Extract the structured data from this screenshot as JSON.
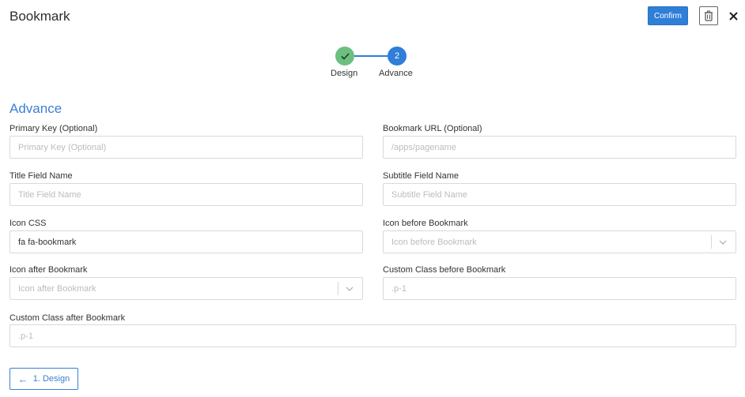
{
  "header": {
    "title": "Bookmark",
    "confirm_label": "Confirm"
  },
  "stepper": {
    "steps": [
      {
        "label": "Design",
        "status": "complete"
      },
      {
        "label": "Advance",
        "number": "2",
        "status": "active"
      }
    ]
  },
  "section": {
    "title": "Advance"
  },
  "fields": {
    "primary_key": {
      "label": "Primary Key (Optional)",
      "placeholder": "Primary Key (Optional)",
      "value": ""
    },
    "bookmark_url": {
      "label": "Bookmark URL (Optional)",
      "placeholder": "/apps/pagename",
      "value": ""
    },
    "title_field": {
      "label": "Title Field Name",
      "placeholder": "Title Field Name",
      "value": ""
    },
    "subtitle_field": {
      "label": "Subtitle Field Name",
      "placeholder": "Subtitle Field Name",
      "value": ""
    },
    "icon_css": {
      "label": "Icon CSS",
      "placeholder": "",
      "value": "fa fa-bookmark"
    },
    "icon_before": {
      "label": "Icon before Bookmark",
      "placeholder": "Icon before Bookmark"
    },
    "icon_after": {
      "label": "Icon after Bookmark",
      "placeholder": "Icon after Bookmark"
    },
    "class_before": {
      "label": "Custom Class before Bookmark",
      "placeholder": ".p-1",
      "value": ""
    },
    "class_after": {
      "label": "Custom Class after Bookmark",
      "placeholder": ".p-1",
      "value": ""
    }
  },
  "footer": {
    "back_label": "1. Design"
  },
  "colors": {
    "accent": "#2f7ed8",
    "complete": "#6cbf7e",
    "section_title": "#3c7fd2"
  }
}
